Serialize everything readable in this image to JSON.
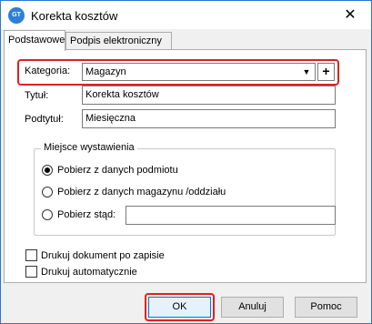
{
  "window": {
    "title": "Korekta kosztów",
    "icon_label": "GT"
  },
  "tabs": [
    {
      "label": "Podstawowe",
      "active": true
    },
    {
      "label": "Podpis elektroniczny",
      "active": false
    }
  ],
  "form": {
    "category_label": "Kategoria:",
    "category_value": "Magazyn",
    "title_label": "Tytuł:",
    "title_value": "Korekta kosztów",
    "subtitle_label": "Podtytuł:",
    "subtitle_value": "Miesięczna"
  },
  "issue_place": {
    "legend": "Miejsce wystawienia",
    "options": [
      {
        "label": "Pobierz z danych podmiotu",
        "checked": true
      },
      {
        "label": "Pobierz z danych magazynu /oddziału",
        "checked": false
      },
      {
        "label": "Pobierz stąd:",
        "checked": false
      }
    ],
    "custom_value": ""
  },
  "checkboxes": [
    {
      "label": "Drukuj dokument po zapisie",
      "checked": false
    },
    {
      "label": "Drukuj automatycznie",
      "checked": false
    }
  ],
  "buttons": {
    "ok": "OK",
    "cancel": "Anuluj",
    "help": "Pomoc"
  },
  "colors": {
    "highlight": "#e02020",
    "accent": "#0078d7",
    "title_bar": "#ffffff"
  }
}
